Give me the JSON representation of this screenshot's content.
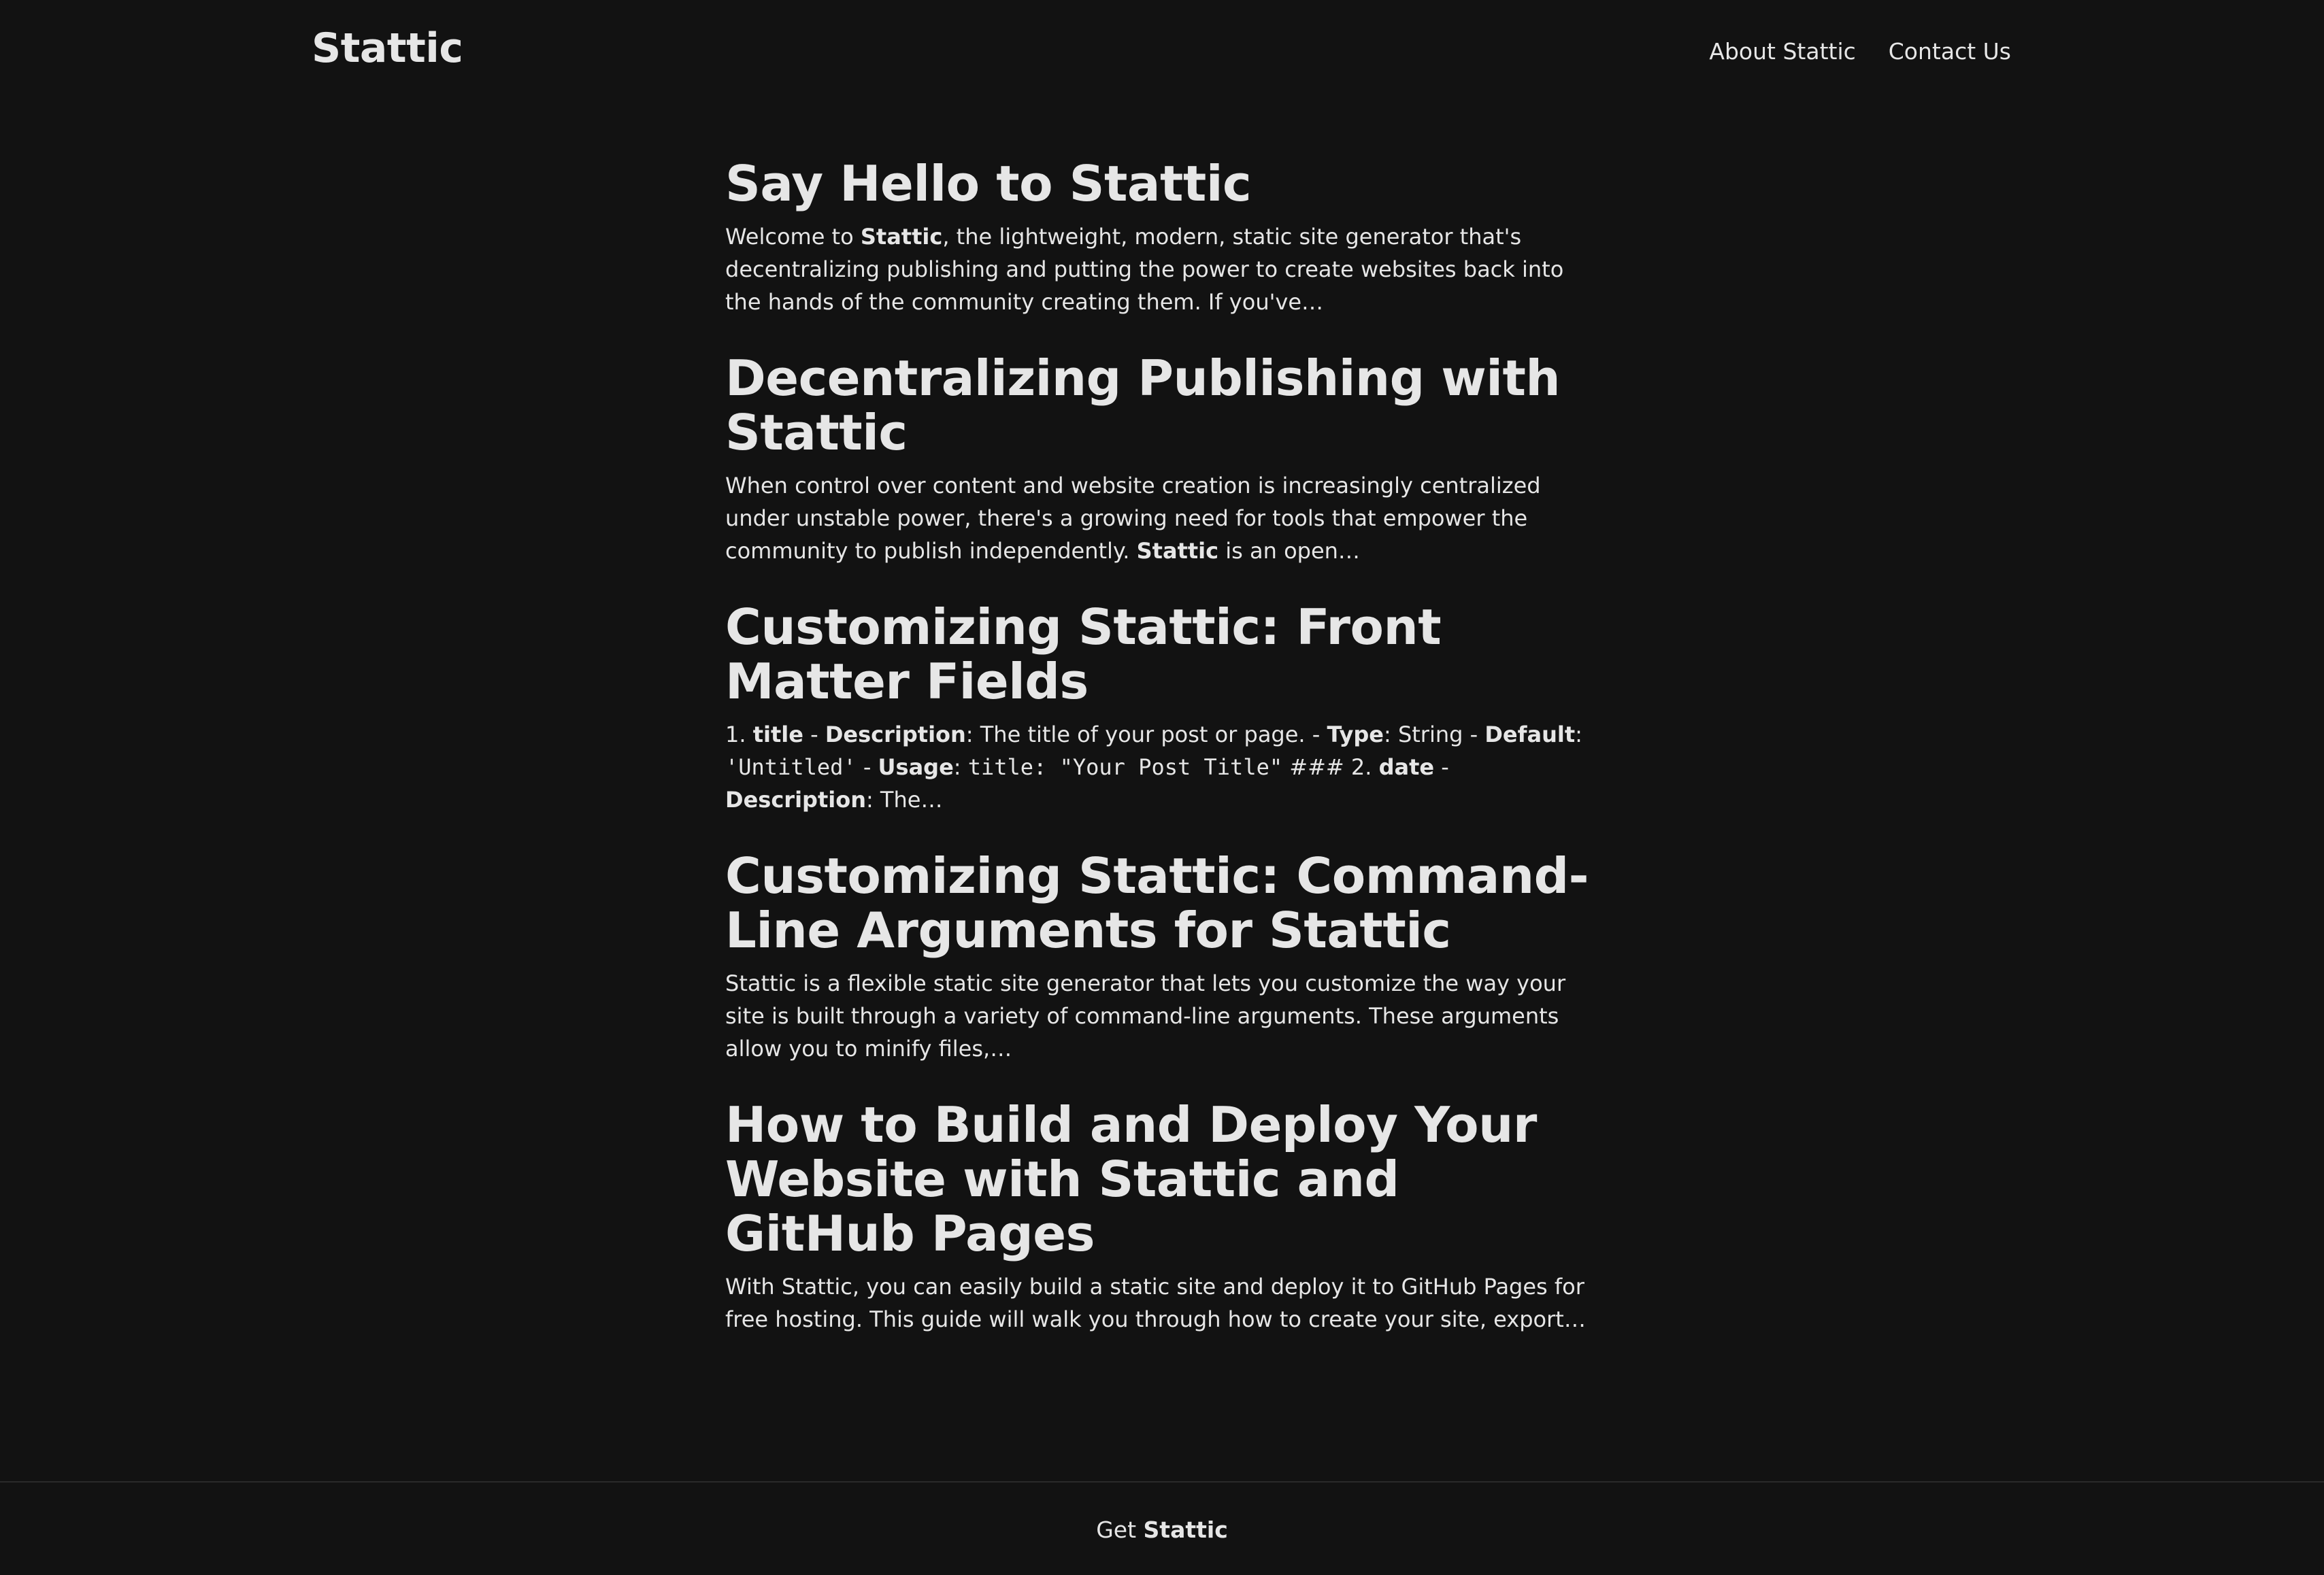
{
  "header": {
    "logo": "Stattic",
    "nav": [
      {
        "label": "About Stattic"
      },
      {
        "label": "Contact Us"
      }
    ]
  },
  "posts": [
    {
      "title": "Say Hello to Stattic",
      "excerpt": [
        {
          "t": "text",
          "v": "Welcome to "
        },
        {
          "t": "bold",
          "v": "Stattic"
        },
        {
          "t": "text",
          "v": ", the lightweight, modern, static site generator that's decentralizing publishing and putting the power to create websites back into the hands of the community creating them. If you've…"
        }
      ]
    },
    {
      "title": "Decentralizing Publishing with Stattic",
      "excerpt": [
        {
          "t": "text",
          "v": "When control over content and website creation is increasingly centralized under unstable power, there's a growing need for tools that empower the community to publish independently. "
        },
        {
          "t": "bold",
          "v": "Stattic"
        },
        {
          "t": "text",
          "v": " is an open…"
        }
      ]
    },
    {
      "title": "Customizing Stattic: Front Matter Fields",
      "excerpt": [
        {
          "t": "text",
          "v": "1. "
        },
        {
          "t": "bold",
          "v": "title"
        },
        {
          "t": "text",
          "v": " - "
        },
        {
          "t": "bold",
          "v": "Description"
        },
        {
          "t": "text",
          "v": ": The title of your post or page. - "
        },
        {
          "t": "bold",
          "v": "Type"
        },
        {
          "t": "text",
          "v": ": String - "
        },
        {
          "t": "bold",
          "v": "Default"
        },
        {
          "t": "text",
          "v": ": "
        },
        {
          "t": "code",
          "v": "'Untitled'"
        },
        {
          "t": "text",
          "v": " - "
        },
        {
          "t": "bold",
          "v": "Usage"
        },
        {
          "t": "text",
          "v": ": "
        },
        {
          "t": "code",
          "v": "title: \"Your Post Title\""
        },
        {
          "t": "text",
          "v": " ### 2. "
        },
        {
          "t": "bold",
          "v": "date"
        },
        {
          "t": "text",
          "v": " - "
        },
        {
          "t": "bold",
          "v": "Description"
        },
        {
          "t": "text",
          "v": ": The…"
        }
      ]
    },
    {
      "title": "Customizing Stattic: Command-Line Arguments for Stattic",
      "excerpt": [
        {
          "t": "text",
          "v": "Stattic is a flexible static site generator that lets you customize the way your site is built through a variety of command-line arguments. These arguments allow you to minify files,…"
        }
      ]
    },
    {
      "title": "How to Build and Deploy Your Website with Stattic and GitHub Pages",
      "excerpt": [
        {
          "t": "text",
          "v": "With Stattic, you can easily build a static site and deploy it to GitHub Pages for free hosting. This guide will walk you through how to create your site, export…"
        }
      ]
    }
  ],
  "footer": {
    "prefix": "Get ",
    "brand": "Stattic"
  }
}
